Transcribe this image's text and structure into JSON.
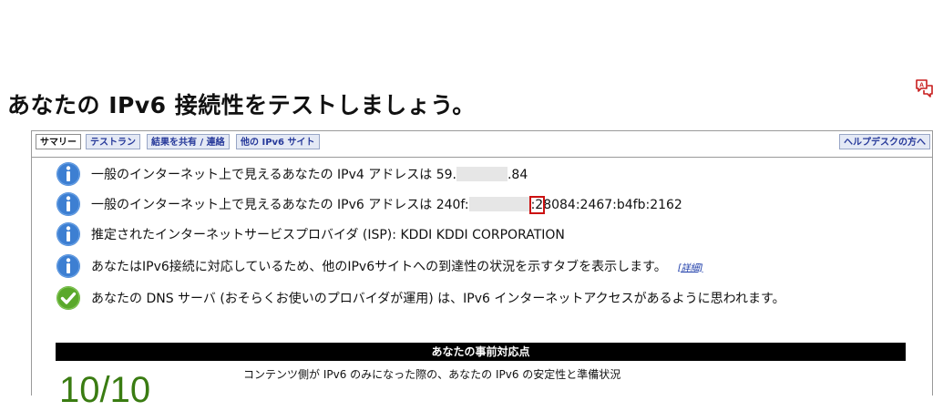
{
  "page": {
    "title": "あなたの IPv6 接続性をテストしましょう。"
  },
  "tabs": [
    {
      "label": "サマリー",
      "active": true
    },
    {
      "label": "テストラン",
      "active": false
    },
    {
      "label": "結果を共有 / 連絡",
      "active": false
    },
    {
      "label": "他の IPv6 サイト",
      "active": false
    }
  ],
  "help_tab": {
    "label": "ヘルプデスクの方へ"
  },
  "summary": {
    "ipv4": {
      "prefix": "一般のインターネット上で見えるあなたの IPv4 アドレスは 59.",
      "suffix": ".84",
      "icon": "info-icon"
    },
    "ipv6": {
      "prefix": "一般のインターネット上で見えるあなたの IPv6 アドレスは 240f:",
      "highlighted": ":2",
      "suffix": "8084:2467:b4fb:2162",
      "icon": "info-icon"
    },
    "isp": {
      "text": "推定されたインターネットサービスプロバイダ (ISP): KDDI KDDI CORPORATION",
      "icon": "info-icon"
    },
    "dual": {
      "text": "あなたはIPv6接続に対応しているため、他のIPv6サイトへの到達性の状況を示すタブを表示します。",
      "link": "[詳細]",
      "icon": "info-icon"
    },
    "dns": {
      "text": "あなたの DNS サーバ (おそらくお使いのプロバイダが運用) は、IPv6 インターネットアクセスがあるように思われます。",
      "icon": "check-icon"
    }
  },
  "readiness": {
    "header": "あなたの事前対応点",
    "score": "10/10",
    "description": "コンテンツ側が IPv6 のみになった際の、あなたの IPv6 の安定性と準備状況"
  },
  "colors": {
    "info_icon": "#3d7fd2",
    "check_icon": "#5aa82b",
    "score": "#3a7c12",
    "tab_bg": "#e4e9f5",
    "tab_text": "#26399a"
  }
}
